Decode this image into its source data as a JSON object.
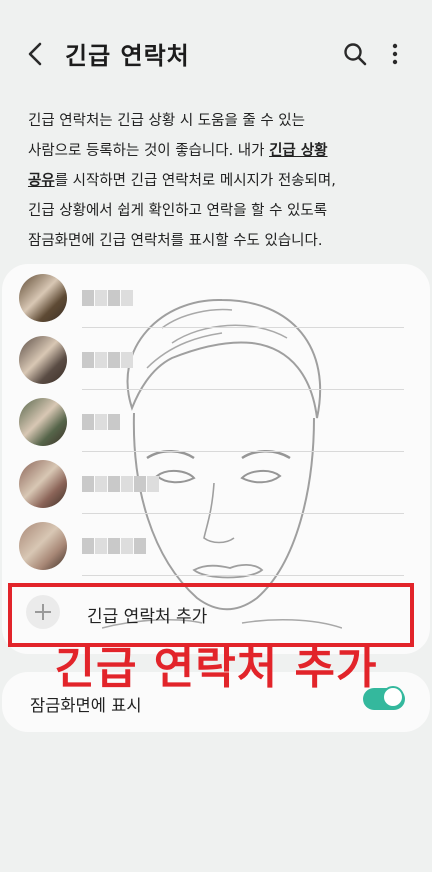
{
  "header": {
    "title": "긴급 연락처",
    "back_icon": "chevron-left-icon",
    "search_icon": "search-icon",
    "more_icon": "more-vertical-icon"
  },
  "description": {
    "line1": "긴급 연락처는 긴급 상황 시 도움을 줄 수 있는",
    "line2_before": "사람으로 등록하는 것이 좋습니다. 내가 ",
    "line2_link": "긴급 상황",
    "line3_link": "공유",
    "line3_after": "를 시작하면 긴급 연락처로 메시지가 전송되며,",
    "line4": "긴급 상황에서 쉽게 확인하고 연락을 할 수 있도록",
    "line5": "잠금화면에 긴급 연락처를 표시할 수도 있습니다."
  },
  "contacts": {
    "count": 5,
    "avatar_colors": [
      "#5e4a34",
      "#5a4c44",
      "#56654a",
      "#8b6458",
      "#a88776"
    ],
    "name_blur_color": "#c9c9c9"
  },
  "add_contact": {
    "label": "긴급 연락처 추가",
    "icon": "plus-icon"
  },
  "annotation": {
    "text": "긴급 연락처 추가",
    "color": "#e2242a"
  },
  "lock_screen": {
    "label": "잠금화면에 표시",
    "toggle_on": true,
    "toggle_color": "#34b89d"
  }
}
